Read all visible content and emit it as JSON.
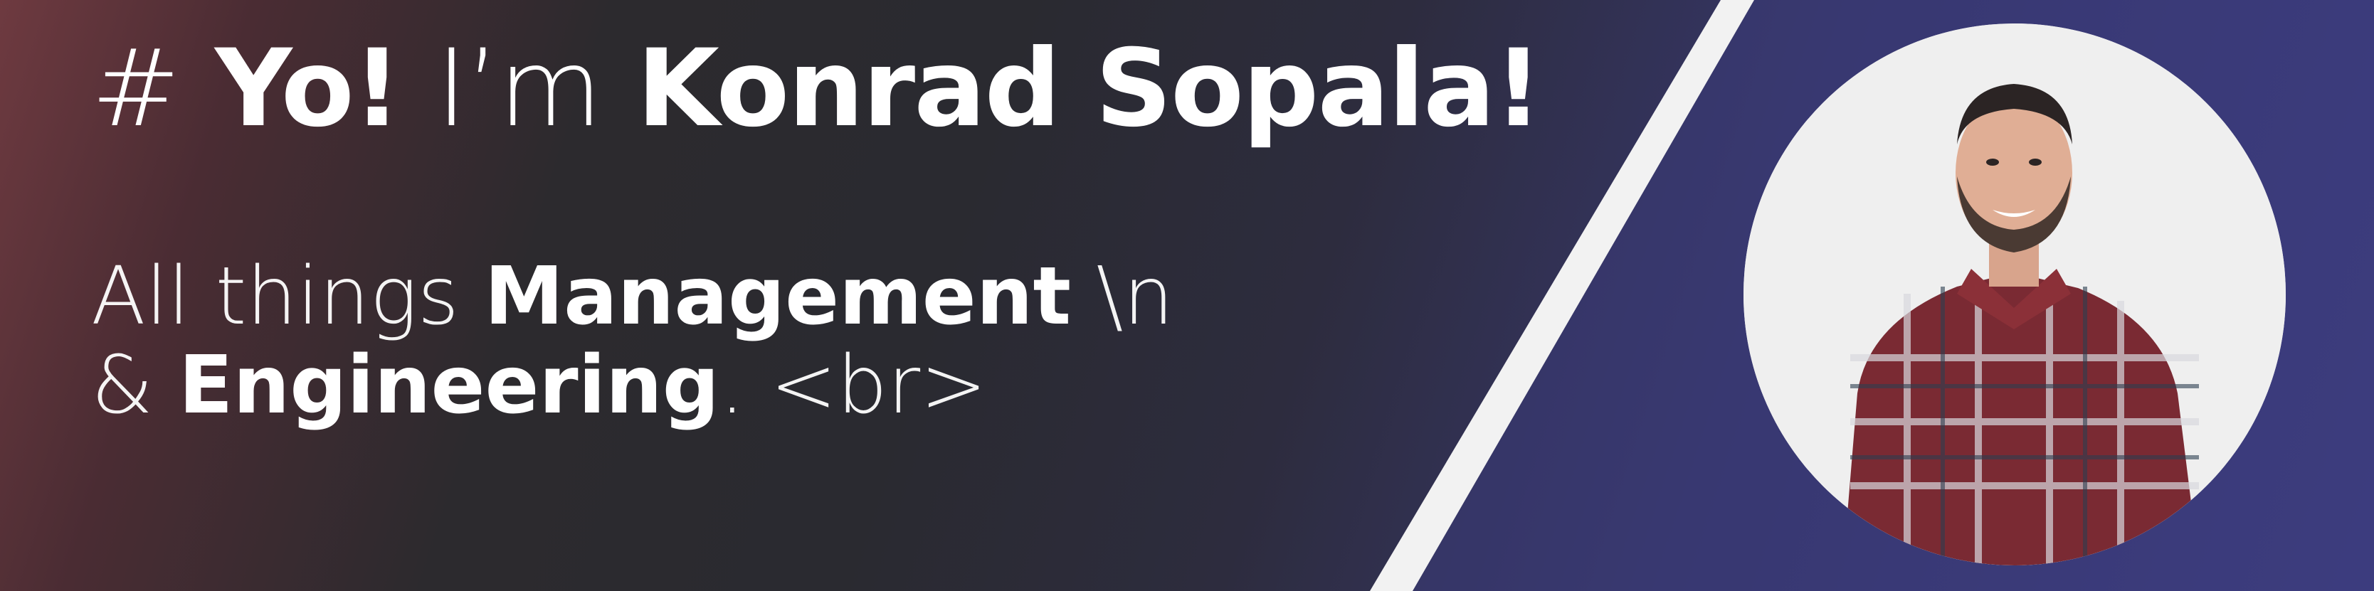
{
  "headline": {
    "hash": "#",
    "greeting": "Yo!",
    "intro": "I’m",
    "name": "Konrad Sopala!"
  },
  "tagline": {
    "line1_prefix": "All things",
    "line1_bold": "Management",
    "line1_suffix": "\\n",
    "line2_prefix": "&",
    "line2_bold": "Engineering",
    "line2_suffix": ". <br>"
  },
  "colors": {
    "text": "#ffffff",
    "divider": "#f2f2f2",
    "accent_left": "#6e3a40",
    "accent_right": "#3f3f86"
  },
  "avatar": {
    "alt": "portrait"
  }
}
